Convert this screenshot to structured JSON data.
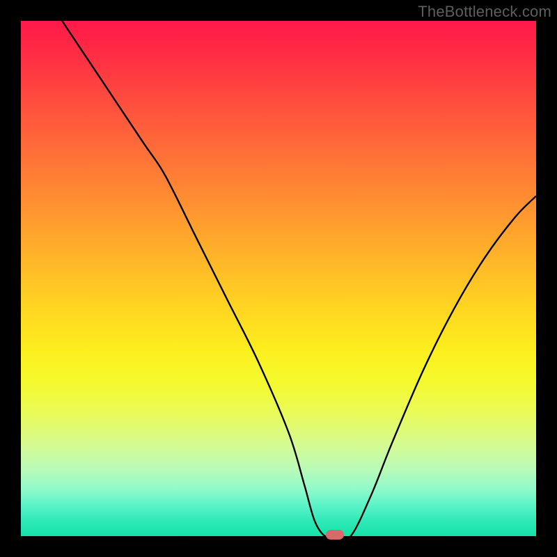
{
  "watermark": "TheBottleneck.com",
  "chart_data": {
    "type": "line",
    "title": "",
    "xlabel": "",
    "ylabel": "",
    "xlim": [
      0,
      100
    ],
    "ylim": [
      0,
      100
    ],
    "grid": false,
    "legend": false,
    "background_gradient": {
      "top": "#ff1a49",
      "mid": "#ffd321",
      "bottom": "#15e2a7"
    },
    "series": [
      {
        "name": "bottleneck-curve",
        "color": "#000000",
        "x": [
          8,
          12,
          18,
          24,
          28,
          34,
          40,
          46,
          52,
          55,
          57,
          59,
          61,
          64,
          68,
          72,
          78,
          84,
          90,
          96,
          100
        ],
        "y": [
          100,
          94,
          85,
          76,
          70,
          58,
          46,
          34,
          20,
          10,
          3,
          0,
          0,
          0,
          8,
          18,
          32,
          44,
          54,
          62,
          66
        ]
      }
    ],
    "marker": {
      "name": "optimal-point",
      "x": 61,
      "y": 0,
      "color": "#d86a6a"
    }
  }
}
